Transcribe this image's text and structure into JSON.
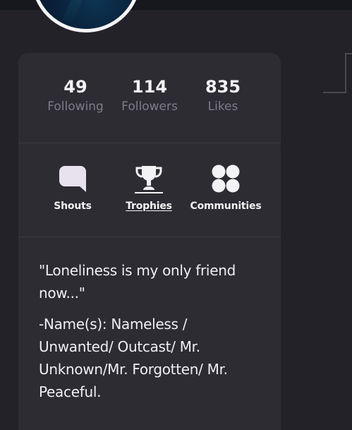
{
  "stats": [
    {
      "value": "49",
      "label": "Following"
    },
    {
      "value": "114",
      "label": "Followers"
    },
    {
      "value": "835",
      "label": "Likes"
    }
  ],
  "nav": [
    {
      "label": "Shouts",
      "icon": "speech-bubble-icon",
      "active": false
    },
    {
      "label": "Trophies",
      "icon": "trophy-icon",
      "active": true
    },
    {
      "label": "Communities",
      "icon": "communities-icon",
      "active": false
    }
  ],
  "bio": {
    "quote": "\"Loneliness is my only friend now...\"",
    "names": "-Name(s): Nameless / Unwanted/ Outcast/ Mr. Unknown/Mr. Forgotten/ Mr. Peaceful."
  },
  "colors": {
    "background": "#242229",
    "card": "#2e2c33",
    "text": "#f3f2f5",
    "muted": "#7e7c85",
    "avatar_border": "#f5f5f7"
  }
}
